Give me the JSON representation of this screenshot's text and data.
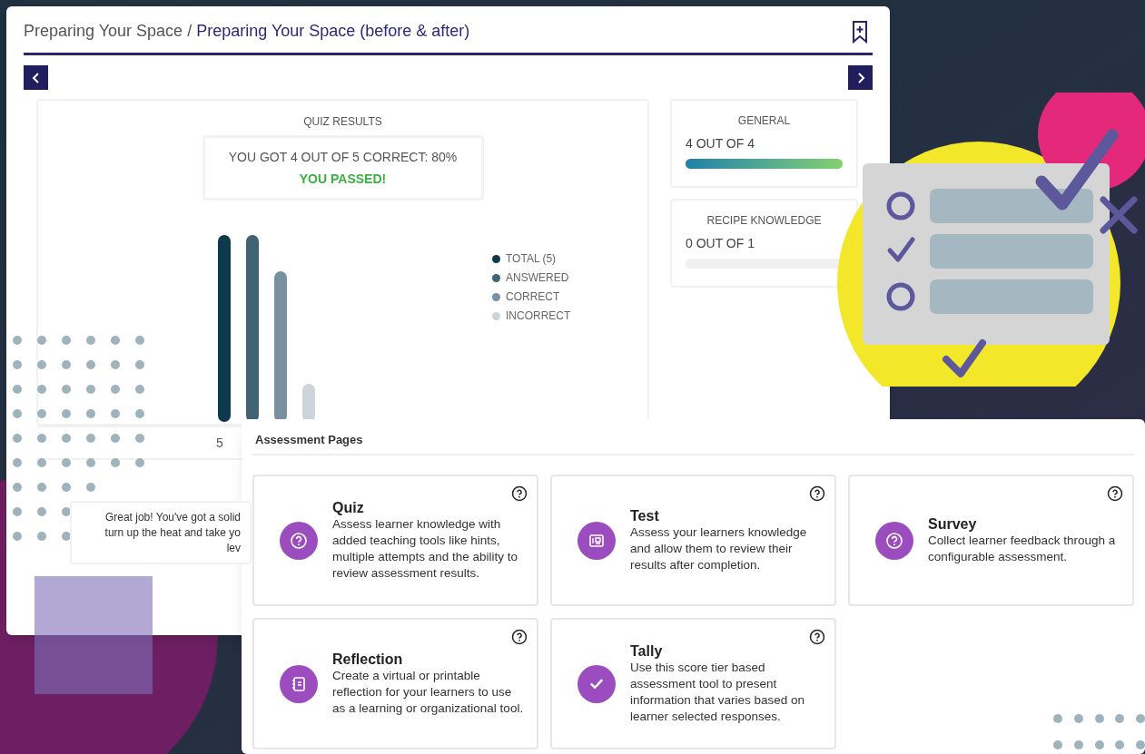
{
  "breadcrumb": {
    "parent": "Preparing Your Space",
    "separator": "/",
    "current": "Preparing Your Space (before & after)"
  },
  "quiz_results": {
    "title": "QUIZ RESULTS",
    "score": "YOU GOT 4 OUT OF 5 CORRECT: 80%",
    "verdict": "YOU PASSED!",
    "passed": true,
    "legend": [
      {
        "label": "TOTAL (5)",
        "color": "#0f3a4d"
      },
      {
        "label": "ANSWERED",
        "color": "#3f6274"
      },
      {
        "label": "CORRECT",
        "color": "#7890a0"
      },
      {
        "label": "INCORRECT",
        "color": "#cdd5da"
      }
    ],
    "count_label": "5",
    "feedback_lines": [
      "Great job! You've got a solid",
      "turn up the heat and take yo",
      "lev"
    ]
  },
  "categories": [
    {
      "title": "GENERAL",
      "score": "4 OUT OF 4",
      "level": 1
    },
    {
      "title": "RECIPE KNOWLEDGE",
      "score": "0 OUT OF 1",
      "level": 0
    }
  ],
  "assessment_pages": {
    "title": "Assessment Pages",
    "cards": [
      {
        "kind": "question",
        "title": "Quiz",
        "description": "Assess learner knowledge with added teaching tools like hints, multiple attempts and the ability to review assessment results."
      },
      {
        "kind": "test",
        "title": "Test",
        "description": "Assess your learners knowledge and allow them to review their results after completion."
      },
      {
        "kind": "question",
        "title": "Survey",
        "description": "Collect learner feedback through a configurable assessment."
      },
      {
        "kind": "notebook",
        "title": "Reflection",
        "description": "Create a virtual or printable reflection for your learners to use as a learning or organizational tool."
      },
      {
        "kind": "check",
        "title": "Tally",
        "description": "Use this score tier based assessment tool to present information that varies based on learner selected responses."
      }
    ]
  }
}
